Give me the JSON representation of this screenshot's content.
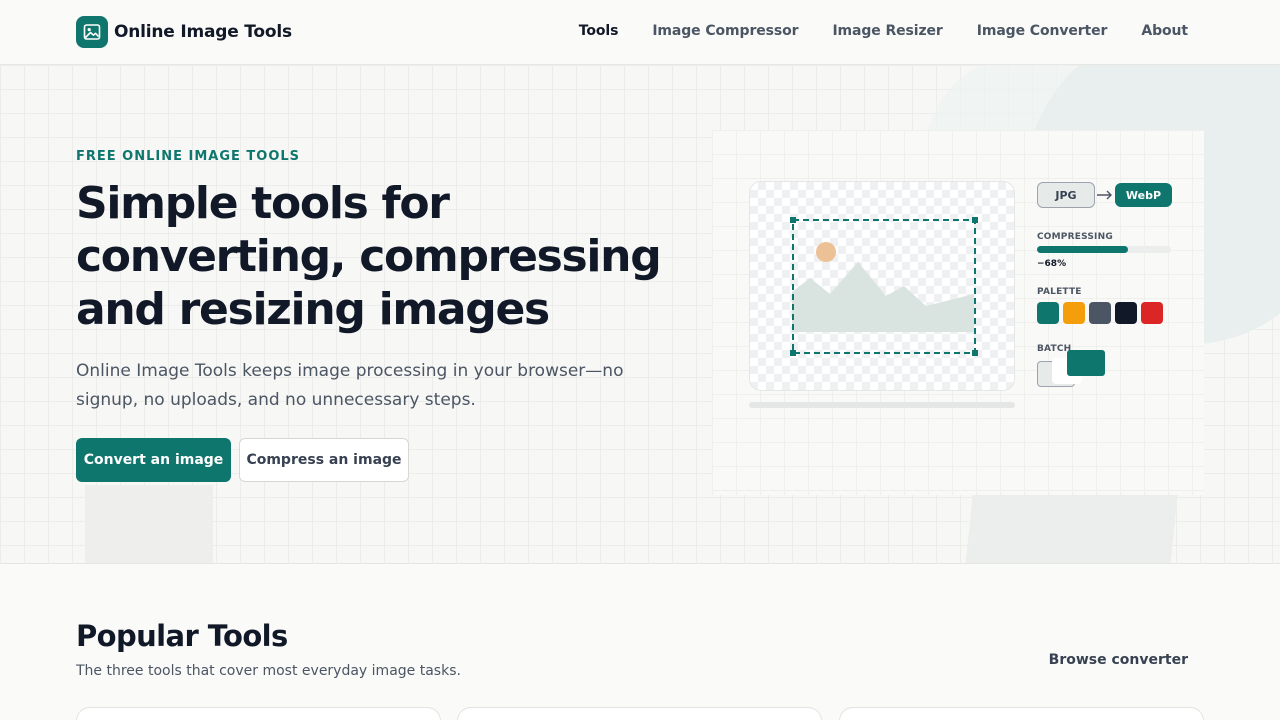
{
  "header": {
    "brand": "Online Image Tools",
    "nav": [
      {
        "label": "Tools",
        "active": true
      },
      {
        "label": "Image Compressor",
        "active": false
      },
      {
        "label": "Image Resizer",
        "active": false
      },
      {
        "label": "Image Converter",
        "active": false
      },
      {
        "label": "About",
        "active": false
      }
    ]
  },
  "hero": {
    "eyebrow": "FREE ONLINE IMAGE TOOLS",
    "title_line1": "Simple tools for",
    "title_line2": "converting, compressing",
    "title_line3": "and resizing images",
    "description": "Online Image Tools keeps image processing in your browser—no signup, no uploads, and no unnecessary steps.",
    "primary_cta": "Convert an image",
    "secondary_cta": "Compress an image"
  },
  "illustration": {
    "format_from": "JPG",
    "format_to": "WebP",
    "compressing_label": "COMPRESSING",
    "compress_progress": 0.68,
    "compress_pct": "−68%",
    "palette_label": "PALETTE",
    "palette": [
      "#0f766e",
      "#f59e0b",
      "#4b5563",
      "#111827",
      "#dc2626"
    ],
    "batch_label": "BATCH",
    "icons": {
      "logo": "image-icon",
      "arrow": "arrow-right-icon",
      "image_placeholder": "mountain-image-icon"
    }
  },
  "popular": {
    "title": "Popular Tools",
    "subtitle": "The three tools that cover most everyday image tasks.",
    "browse_link": "Browse converter"
  },
  "colors": {
    "accent": "#0f766e",
    "text": "#111827",
    "muted": "#4b5563"
  }
}
